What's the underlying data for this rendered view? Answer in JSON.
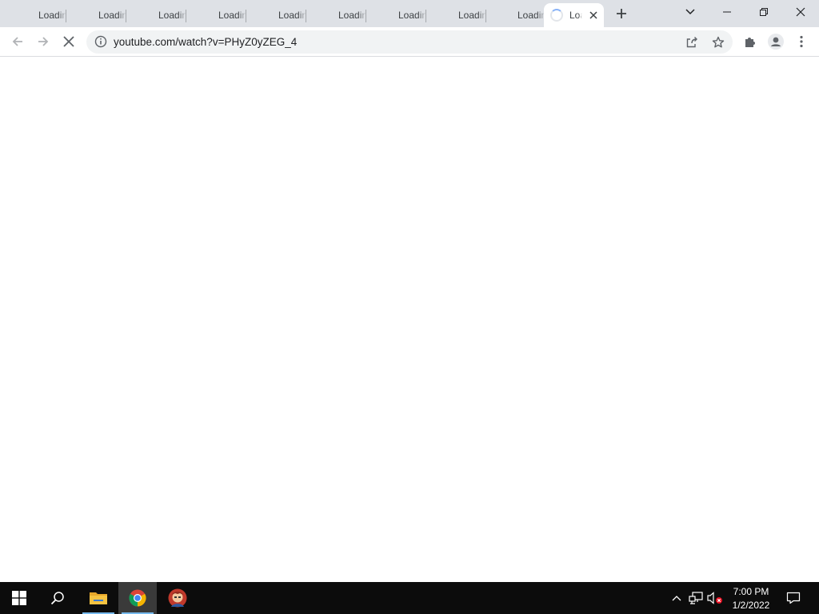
{
  "browser": {
    "tabs": [
      {
        "title": "Loading"
      },
      {
        "title": "Loading"
      },
      {
        "title": "Loading"
      },
      {
        "title": "Loading"
      },
      {
        "title": "Loading"
      },
      {
        "title": "Loading"
      },
      {
        "title": "Loading"
      },
      {
        "title": "Loading"
      },
      {
        "title": "Loading"
      },
      {
        "title": "Loading",
        "active": true
      }
    ],
    "url": "youtube.com/watch?v=PHyZ0yZEG_4",
    "icons": {
      "back": "arrow-left-icon",
      "forward": "arrow-right-icon",
      "stop": "close-icon",
      "site_info": "info-icon",
      "share": "share-icon",
      "bookmark": "star-icon",
      "extensions": "puzzle-icon",
      "profile": "person-icon",
      "menu": "kebab-menu-icon"
    }
  },
  "taskbar": {
    "apps": [
      "start",
      "search",
      "file-explorer",
      "chrome",
      "user-app"
    ],
    "clock": {
      "time": "7:00 PM",
      "date": "1/2/2022"
    }
  },
  "colors": {
    "tabstrip": "#dee1e6",
    "taskbar": "#0c0c0c",
    "accent": "#76b9ed"
  }
}
